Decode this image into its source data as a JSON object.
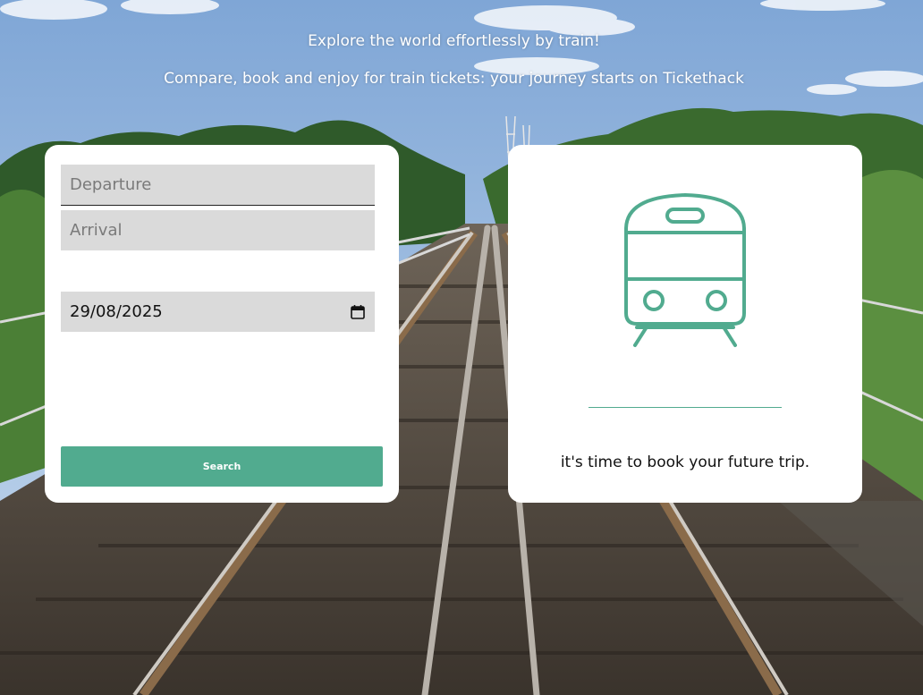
{
  "header": {
    "title": "Explore the world effortlessly by train!",
    "subtitle": "Compare, book and enjoy for train tickets: your journey starts on Tickethack"
  },
  "search": {
    "departure_placeholder": "Departure",
    "arrival_placeholder": "Arrival",
    "date_value": "29/08/2025",
    "search_label": "Search"
  },
  "result": {
    "icon": "train-icon",
    "message": "it's time to book your future trip."
  },
  "colors": {
    "accent": "#51ab8f",
    "field_bg": "#dadada",
    "card_bg": "#ffffff"
  }
}
